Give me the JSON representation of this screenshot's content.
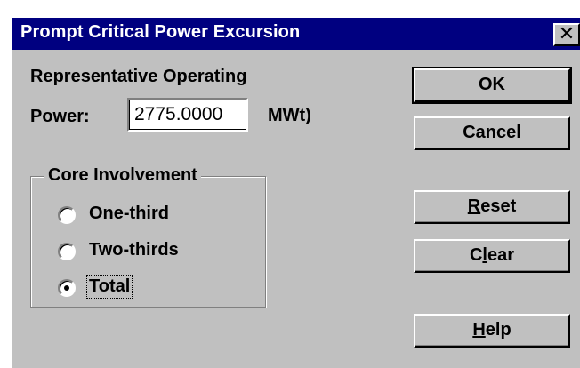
{
  "window": {
    "title": "Prompt Critical Power Excursion",
    "close_glyph": "✕"
  },
  "power": {
    "label_line1": "Representative Operating",
    "label_line2": "Power:",
    "value": "2775.0000",
    "unit": "MWt)"
  },
  "core_involvement": {
    "legend": "Core Involvement",
    "options": [
      {
        "label": "One-third",
        "selected": false
      },
      {
        "label": "Two-thirds",
        "selected": false
      },
      {
        "label": "Total",
        "selected": true
      }
    ]
  },
  "buttons": {
    "ok": "OK",
    "cancel": "Cancel",
    "reset_mnemonic": "R",
    "reset_rest": "eset",
    "clear_pre": "C",
    "clear_mnemonic": "l",
    "clear_rest": "ear",
    "help_mnemonic": "H",
    "help_rest": "elp"
  },
  "colors": {
    "titlebar": "#000080",
    "dialog_face": "#c0c0c0"
  }
}
